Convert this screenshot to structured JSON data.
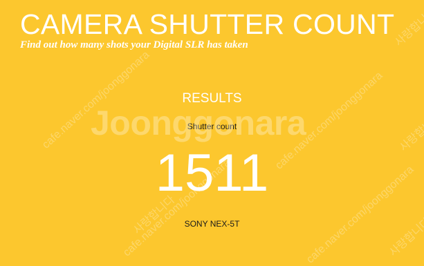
{
  "header": {
    "title": "CAMERA SHUTTER COUNT",
    "subtitle": "Find out how many shots your Digital SLR has taken"
  },
  "results": {
    "heading": "RESULTS",
    "count_label": "Shutter count",
    "count_value": "1511",
    "camera_model": "SONY NEX-5T"
  },
  "watermark": {
    "logo": "Joonggonara",
    "url_text": "cafe.naver.com/joonggonara",
    "korean_text": "사랑합니다"
  },
  "colors": {
    "background": "#fcc72e",
    "text_primary": "#ffffff",
    "text_dark": "#1a1a1a"
  }
}
